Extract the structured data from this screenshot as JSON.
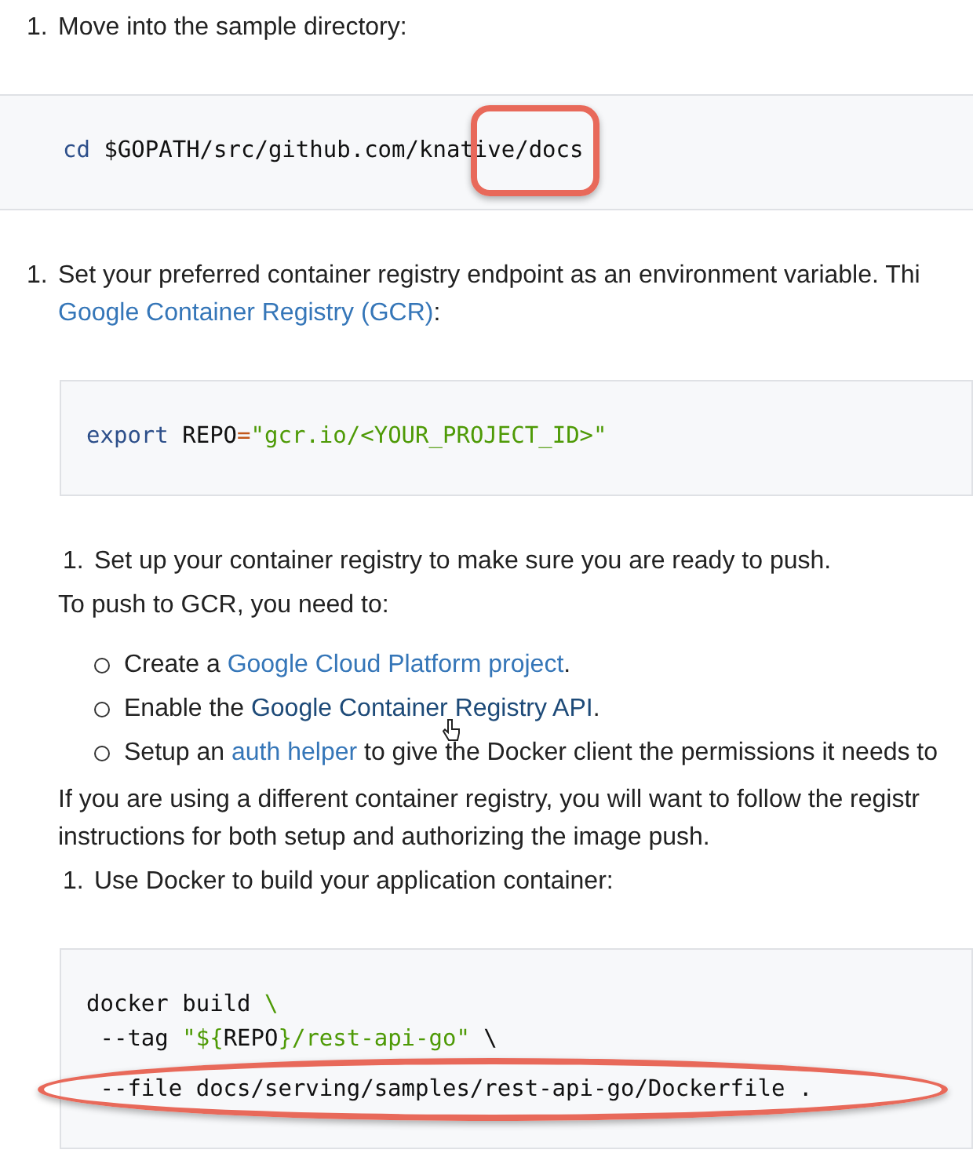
{
  "blocks": [
    {
      "kind": "step",
      "number": "1.",
      "lines": [
        [
          {
            "kind": "text",
            "text": "Move into the sample directory:"
          }
        ]
      ]
    },
    {
      "kind": "code-wide",
      "annotation": {
        "kind": "box"
      },
      "lines": [
        [
          {
            "kind": "keyword",
            "text": "cd"
          },
          {
            "kind": "plain",
            "text": " $GOPATH/src/github.com/knative/docs"
          }
        ]
      ]
    },
    {
      "kind": "step",
      "number": "1.",
      "lines": [
        [
          {
            "kind": "text",
            "text": "Set your preferred container registry endpoint as an environment variable. Thi"
          }
        ],
        [
          {
            "kind": "link",
            "text": "Google Container Registry (GCR)",
            "hovered": false
          },
          {
            "kind": "text",
            "text": ":"
          }
        ]
      ]
    },
    {
      "kind": "code",
      "lines": [
        [
          {
            "kind": "keyword",
            "text": "export"
          },
          {
            "kind": "plain",
            "text": " REPO"
          },
          {
            "kind": "operator",
            "text": "="
          },
          {
            "kind": "string",
            "text": "\"gcr.io/<YOUR_PROJECT_ID>\""
          }
        ]
      ]
    },
    {
      "kind": "substep",
      "number": "1.",
      "lines": [
        [
          {
            "kind": "text",
            "text": "Set up your container registry to make sure you are ready to push."
          }
        ]
      ]
    },
    {
      "kind": "paragraph",
      "lines": [
        [
          {
            "kind": "text",
            "text": "To push to GCR, you need to:"
          }
        ]
      ]
    },
    {
      "kind": "bullets",
      "items": [
        [
          {
            "kind": "text",
            "text": "Create a "
          },
          {
            "kind": "link",
            "text": "Google Cloud Platform project",
            "hovered": false
          },
          {
            "kind": "text",
            "text": "."
          }
        ],
        [
          {
            "kind": "text",
            "text": "Enable the "
          },
          {
            "kind": "link",
            "text": "Google Container Registry API",
            "hovered": true
          },
          {
            "kind": "text",
            "text": "."
          }
        ],
        [
          {
            "kind": "text",
            "text": "Setup an "
          },
          {
            "kind": "link",
            "text": "auth helper",
            "hovered": false
          },
          {
            "kind": "text",
            "text": " to give the Docker client the permissions it needs to"
          }
        ]
      ]
    },
    {
      "kind": "paragraph",
      "lines": [
        [
          {
            "kind": "text",
            "text": "If you are using a different container registry, you will want to follow the registr"
          }
        ],
        [
          {
            "kind": "text",
            "text": "instructions for both setup and authorizing the image push."
          }
        ]
      ]
    },
    {
      "kind": "substep",
      "number": "1.",
      "lines": [
        [
          {
            "kind": "text",
            "text": "Use Docker to build your application container:"
          }
        ]
      ]
    },
    {
      "kind": "code",
      "annotation": {
        "kind": "ellipse"
      },
      "lines": [
        [
          {
            "kind": "plain",
            "text": "docker build "
          },
          {
            "kind": "string",
            "text": "\\"
          }
        ],
        [
          {
            "kind": "plain",
            "text": " --tag "
          },
          {
            "kind": "string",
            "text": "\"${"
          },
          {
            "kind": "plain",
            "text": "REPO"
          },
          {
            "kind": "string",
            "text": "}/rest-api-go\""
          },
          {
            "kind": "plain",
            "text": " \\"
          }
        ],
        [
          {
            "kind": "plain",
            "text": " --file docs/serving/samples/rest-api-go/Dockerfile ."
          }
        ]
      ]
    }
  ]
}
